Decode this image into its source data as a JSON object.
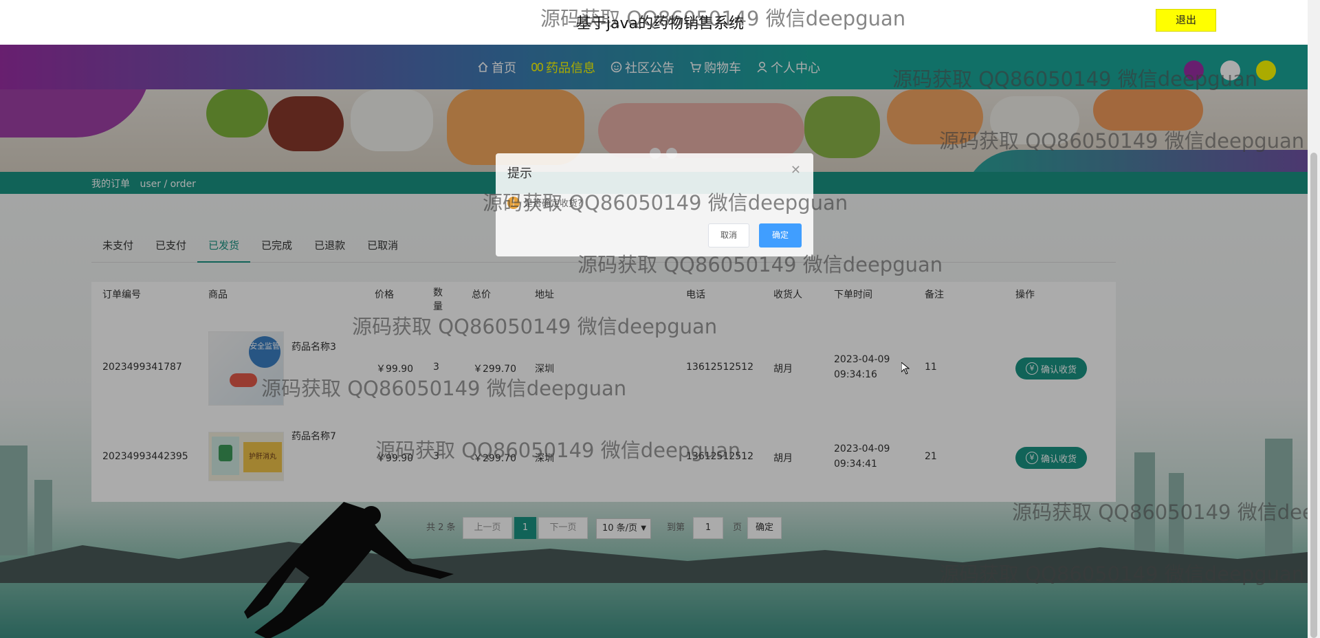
{
  "header": {
    "site_title": "基于java的药物销售系统",
    "logout": "退出"
  },
  "nav": {
    "items": [
      {
        "label": "首页",
        "icon": "home-icon"
      },
      {
        "label": "药品信息",
        "icon": "pills-icon",
        "active": true
      },
      {
        "label": "社区公告",
        "icon": "smile-icon"
      },
      {
        "label": "购物车",
        "icon": "cart-icon"
      },
      {
        "label": "个人中心",
        "icon": "user-icon"
      }
    ],
    "theme_dots": [
      "#9b2fa6",
      "#ffffff",
      "#ffff00"
    ]
  },
  "breadcrumb": {
    "title": "我的订单",
    "path": "user / order"
  },
  "tabs": [
    "未支付",
    "已支付",
    "已发货",
    "已完成",
    "已退款",
    "已取消"
  ],
  "active_tab": "已发货",
  "table": {
    "headers": [
      "订单编号",
      "商品",
      "价格",
      "数量",
      "总价",
      "地址",
      "电话",
      "收货人",
      "下单时间",
      "备注",
      "操作"
    ],
    "rows": [
      {
        "order_no": "2023499341787",
        "product": "药品名称3",
        "thumb_text": "安全监管",
        "price": "￥99.90",
        "qty": "3",
        "total": "￥299.70",
        "address": "深圳",
        "phone": "13612512512",
        "receiver": "胡月",
        "date": "2023-04-09",
        "time": "09:34:16",
        "note": "11",
        "action": "确认收货"
      },
      {
        "order_no": "20234993442395",
        "product": "药品名称7",
        "thumb_text": "护肝消丸",
        "price": "￥99.90",
        "qty": "3",
        "total": "￥299.70",
        "address": "深圳",
        "phone": "13612512512",
        "receiver": "胡月",
        "date": "2023-04-09",
        "time": "09:34:41",
        "note": "21",
        "action": "确认收货"
      }
    ]
  },
  "pagination": {
    "total": "共 2 条",
    "prev": "上一页",
    "current": "1",
    "next": "下一页",
    "page_size": "10 条/页",
    "goto_label": "到第",
    "goto_value": "1",
    "page_unit": "页",
    "confirm": "确定"
  },
  "dialog": {
    "title": "提示",
    "message": "是否确定收货?",
    "cancel": "取消",
    "ok": "确定"
  },
  "watermark": "源码获取 QQ86050149 微信deepguan",
  "colors": {
    "accent": "#1a9484",
    "active_nav": "#ffff00",
    "logout_bg": "#ffff00",
    "dialog_ok": "#409eff"
  }
}
